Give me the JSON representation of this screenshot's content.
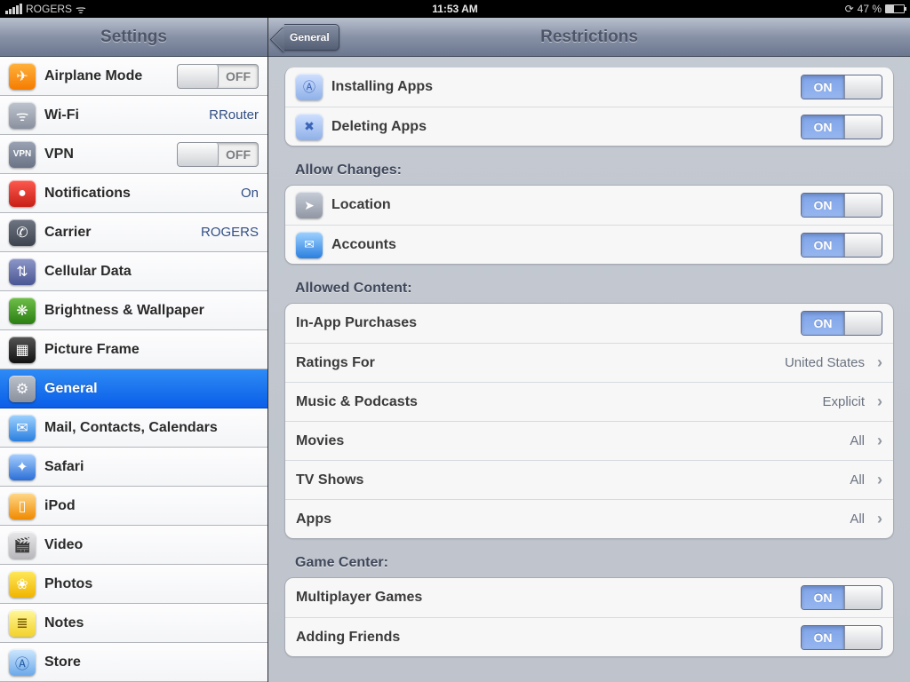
{
  "status": {
    "carrier": "ROGERS",
    "time": "11:53 AM",
    "battery_pct": "47 %"
  },
  "sidebar": {
    "title": "Settings",
    "items": [
      {
        "label": "Airplane Mode",
        "toggle": "OFF"
      },
      {
        "label": "Wi-Fi",
        "value": "RRouter"
      },
      {
        "label": "VPN",
        "toggle": "OFF"
      },
      {
        "label": "Notifications",
        "value": "On"
      },
      {
        "label": "Carrier",
        "value": "ROGERS"
      },
      {
        "label": "Cellular Data"
      },
      {
        "label": "Brightness & Wallpaper"
      },
      {
        "label": "Picture Frame"
      },
      {
        "label": "General"
      },
      {
        "label": "Mail, Contacts, Calendars"
      },
      {
        "label": "Safari"
      },
      {
        "label": "iPod"
      },
      {
        "label": "Video"
      },
      {
        "label": "Photos"
      },
      {
        "label": "Notes"
      },
      {
        "label": "Store"
      }
    ]
  },
  "detail": {
    "back": "General",
    "title": "Restrictions",
    "groups": {
      "top": [
        {
          "label": "Installing Apps",
          "toggle": "ON"
        },
        {
          "label": "Deleting Apps",
          "toggle": "ON"
        }
      ],
      "allow_changes_header": "Allow Changes:",
      "allow_changes": [
        {
          "label": "Location",
          "toggle": "ON"
        },
        {
          "label": "Accounts",
          "toggle": "ON"
        }
      ],
      "allowed_content_header": "Allowed Content:",
      "allowed_content": [
        {
          "label": "In-App Purchases",
          "toggle": "ON"
        },
        {
          "label": "Ratings For",
          "value": "United States"
        },
        {
          "label": "Music & Podcasts",
          "value": "Explicit"
        },
        {
          "label": "Movies",
          "value": "All"
        },
        {
          "label": "TV Shows",
          "value": "All"
        },
        {
          "label": "Apps",
          "value": "All"
        }
      ],
      "game_center_header": "Game Center:",
      "game_center": [
        {
          "label": "Multiplayer Games",
          "toggle": "ON"
        },
        {
          "label": "Adding Friends",
          "toggle": "ON"
        }
      ]
    }
  }
}
